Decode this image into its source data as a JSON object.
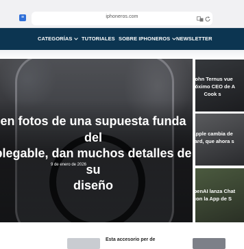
{
  "browser": {
    "url": "iphoneros.com"
  },
  "nav": {
    "items": [
      {
        "label": "CATEGORÍAS",
        "has_dropdown": true
      },
      {
        "label": "TUTORIALES",
        "has_dropdown": false
      },
      {
        "label": "SOBRE IPHONEROS",
        "has_dropdown": true
      },
      {
        "label": "NEWSLETTER",
        "has_dropdown": false
      }
    ]
  },
  "hero": {
    "title_lines": [
      "en fotos de una supuesta funda del",
      "plegable, dan muchos detalles de su",
      "diseño"
    ],
    "date": "9 de enero de 2026"
  },
  "side_cards": [
    {
      "lines": [
        "John Ternus vue",
        "próximo CEO de A",
        "Cook s"
      ]
    },
    {
      "lines": [
        "Apple cambia de",
        "Card, que ahora s"
      ]
    },
    {
      "lines": [
        "OpenAI lanza Chat",
        "con la App de S"
      ]
    }
  ],
  "bottom": {
    "teaser_text": "Esta accesorio per de"
  },
  "colors": {
    "nav_bg": "#0c3551",
    "chrome_bg": "#f1f1f3"
  }
}
